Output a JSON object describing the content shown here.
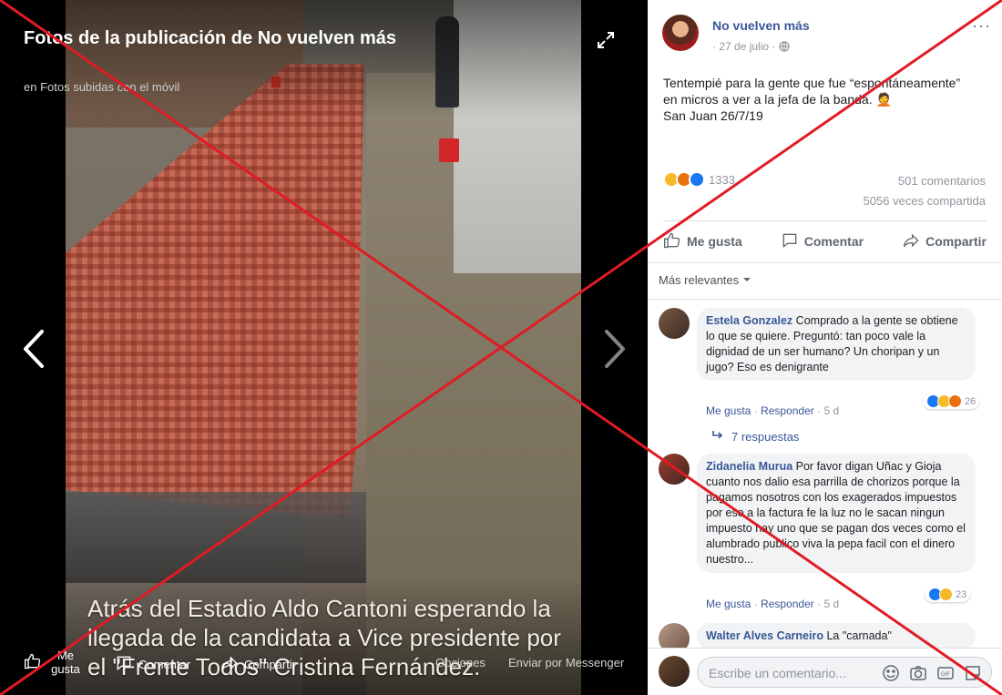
{
  "viewer": {
    "title": "Fotos de la publicación de No vuelven más",
    "subtitle": "en Fotos subidas con el móvil",
    "photo_caption": "Atrás del Estadio Aldo Cantoni esperando la llegada de la candidata a Vice presidente por el \"Frente Todos\" Cristina Fernández.",
    "bottom": {
      "like_label": "Me gusta",
      "comment_label": "Comentar",
      "share_label": "Compartir",
      "options_label": "Opciones",
      "messenger_label": "Enviar por Messenger"
    }
  },
  "post": {
    "page_name": "No vuelven más",
    "date": "· 27 de julio ·",
    "more": "···",
    "text_lines": [
      "Tentempié para la gente que fue “espontáneamente”",
      "en micros a ver a la jefa de la banda. 🤦",
      "San Juan 26/7/19"
    ],
    "reactions_count": "1333",
    "comments_count": "501 comentarios",
    "shares_count": "5056 veces compartida",
    "actions": {
      "like": "Me gusta",
      "comment": "Comentar",
      "share": "Compartir"
    },
    "sort_label": "Más relevantes"
  },
  "comments": [
    {
      "author": "Estela Gonzalez",
      "text": "Comprado a la gente se obtiene lo que se quiere. Preguntó: tan poco vale la dignidad de un ser humano? Un choripan y un jugo? Eso es denigrante",
      "meta_like": "Me gusta",
      "meta_reply": "Responder",
      "age": "5 d",
      "reaction_count": "26",
      "replies": "7 respuestas"
    },
    {
      "author": "Zidanelia Murua",
      "text": "Por favor digan Uñac y Gioja cuanto nos dalio esa parrilla de chorizos porque la pagamos nosotros con los exagerados impuestos por eso a la factura fe la luz no le sacan ningun impuesto hay uno que se pagan dos veces como el alumbrado publico viva la pepa facil con el dinero nuestro...",
      "meta_like": "Me gusta",
      "meta_reply": "Responder",
      "age": "5 d",
      "reaction_count": "23"
    },
    {
      "author": "Walter Alves Carneiro",
      "text": "La \"carnada\""
    }
  ],
  "composer": {
    "placeholder": "Escribe un comentario..."
  },
  "colors": {
    "link": "#385898",
    "overlay_x": "#e01b24"
  },
  "icons": [
    "expand-icon",
    "chevron-left-icon",
    "chevron-right-icon",
    "thumbs-up-icon",
    "comment-icon",
    "share-icon",
    "globe-icon",
    "caret-down-icon",
    "reply-arrow-icon",
    "emoji-icon",
    "camera-icon",
    "gif-icon",
    "sticker-icon"
  ]
}
